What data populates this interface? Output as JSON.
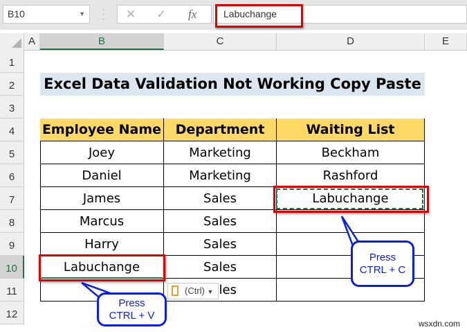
{
  "name_box": "B10",
  "formula_bar": {
    "cancel_icon": "✕",
    "enter_icon": "✓",
    "fx_label": "fx",
    "value": "Labuchange"
  },
  "columns": [
    "A",
    "B",
    "C",
    "D",
    "E"
  ],
  "rows": [
    "1",
    "2",
    "3",
    "4",
    "5",
    "6",
    "7",
    "8",
    "9",
    "10",
    "11",
    "12"
  ],
  "title": "Excel Data Validation Not Working Copy Paste",
  "table": {
    "headers": [
      "Employee Name",
      "Department",
      "Waiting List"
    ],
    "rows": [
      [
        "Joey",
        "Marketing",
        "Beckham"
      ],
      [
        "Daniel",
        "Marketing",
        "Rashford"
      ],
      [
        "James",
        "Sales",
        "Labuchange"
      ],
      [
        "Marcus",
        "Sales",
        ""
      ],
      [
        "Harry",
        "Sales",
        ""
      ],
      [
        "Labuchange",
        "Sales",
        ""
      ],
      [
        "",
        "Sales",
        ""
      ]
    ]
  },
  "paste_options": {
    "label": "(Ctrl)"
  },
  "callouts": {
    "copy": [
      "Press",
      "CTRL + C"
    ],
    "paste": [
      "Press",
      "CTRL + V"
    ]
  },
  "watermark": "wsxdn.com",
  "colors": {
    "header_fill": "#ffd966",
    "title_fill": "#dce6f1",
    "highlight": "#e00000",
    "callout": "#0a1fe0",
    "excel_green": "#217346"
  }
}
